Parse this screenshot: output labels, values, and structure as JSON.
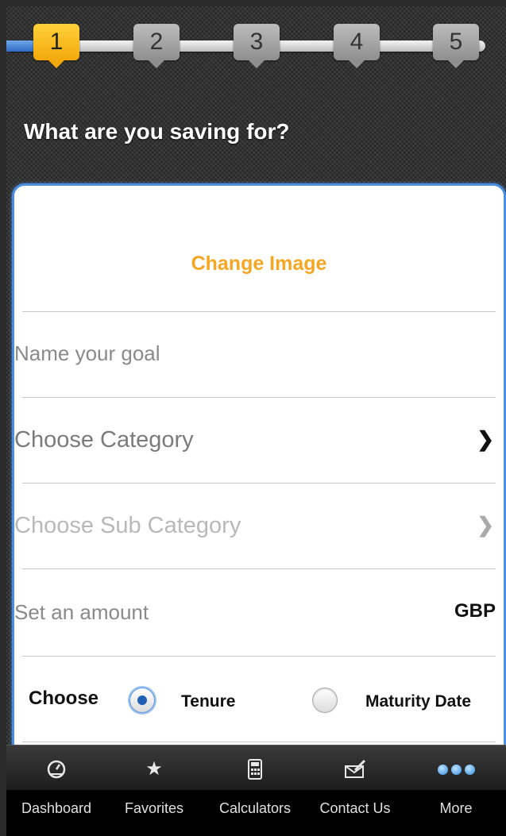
{
  "stepper": {
    "steps": [
      "1",
      "2",
      "3",
      "4",
      "5"
    ],
    "active_step": 1
  },
  "question": "What are you saving for?",
  "form": {
    "change_image": "Change Image",
    "goal_placeholder": "Name your goal",
    "category_placeholder": "Choose Category",
    "subcategory_placeholder": "Choose Sub Category",
    "amount_placeholder": "Set an amount",
    "currency": "GBP",
    "choose_label": "Choose",
    "options": [
      {
        "label": "Tenure",
        "selected": true
      },
      {
        "label": "Maturity Date",
        "selected": false
      }
    ]
  },
  "tabbar": {
    "items": [
      {
        "label": "Dashboard",
        "icon": "dashboard-icon"
      },
      {
        "label": "Favorites",
        "icon": "star-icon"
      },
      {
        "label": "Calculators",
        "icon": "calculator-icon"
      },
      {
        "label": "Contact Us",
        "icon": "contact-icon"
      },
      {
        "label": "More",
        "icon": "more-icon"
      }
    ]
  }
}
